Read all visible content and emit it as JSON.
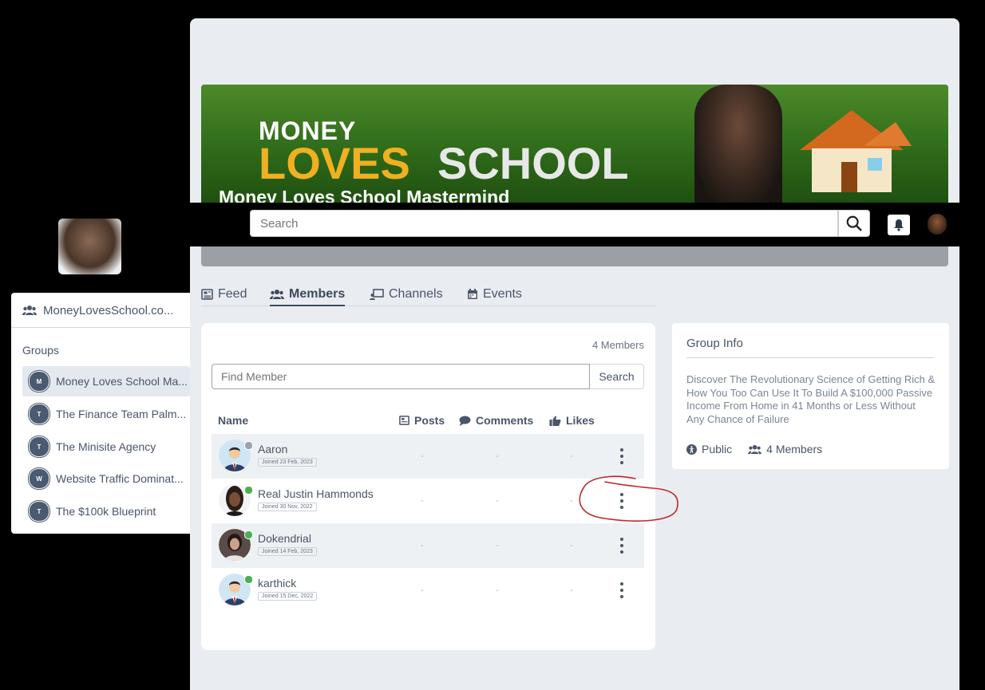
{
  "banner": {
    "money": "MONEY",
    "loves": "LOVES",
    "school": "SCHOOL",
    "title": "Money Loves School Mastermind"
  },
  "topbar": {
    "search_placeholder": "Search",
    "search_icon": "magnifier-icon",
    "bell_icon": "bell-icon"
  },
  "sidebar": {
    "site_label": "MoneyLovesSchool.co...",
    "groups_label": "Groups",
    "groups": [
      {
        "initial": "M",
        "label": "Money Loves School Ma...",
        "active": true
      },
      {
        "initial": "T",
        "label": "The Finance Team Palm...",
        "active": false
      },
      {
        "initial": "T",
        "label": "The Minisite Agency",
        "active": false
      },
      {
        "initial": "W",
        "label": "Website Traffic Dominat...",
        "active": false
      },
      {
        "initial": "T",
        "label": "The $100k Blueprint",
        "active": false
      }
    ]
  },
  "tabs": [
    {
      "label": "Feed",
      "icon": "newspaper-icon"
    },
    {
      "label": "Members",
      "icon": "users-icon",
      "active": true
    },
    {
      "label": "Channels",
      "icon": "channels-icon"
    },
    {
      "label": "Events",
      "icon": "calendar-icon"
    }
  ],
  "members": {
    "count_label": "4 Members",
    "find_placeholder": "Find Member",
    "find_button": "Search",
    "headers": {
      "name": "Name",
      "posts": "Posts",
      "comments": "Comments",
      "likes": "Likes"
    },
    "rows": [
      {
        "name": "Aaron",
        "joined": "Joined 23 Feb, 2023",
        "posts": "-",
        "comments": "-",
        "likes": "-",
        "online": false,
        "avatar": "default"
      },
      {
        "name": "Real Justin Hammonds",
        "joined": "Joined 30 Nov, 2022",
        "posts": "-",
        "comments": "-",
        "likes": "-",
        "online": true,
        "avatar": "photo"
      },
      {
        "name": "Dokendrial",
        "joined": "Joined 14 Feb, 2023",
        "posts": "-",
        "comments": "-",
        "likes": "-",
        "online": true,
        "avatar": "photo2"
      },
      {
        "name": "karthick",
        "joined": "Joined 15 Dec, 2022",
        "posts": "-",
        "comments": "-",
        "likes": "-",
        "online": true,
        "avatar": "default"
      }
    ]
  },
  "group_info": {
    "title": "Group Info",
    "description": "Discover The Revolutionary Science of Getting Rich & How You Too Can Use It To Build A $100,000 Passive Income From Home in 41 Months or Less Without Any Chance of Failure",
    "privacy": "Public",
    "members": "4 Members"
  },
  "colors": {
    "online": "#4caf50",
    "offline": "#9ca3af",
    "annotation": "#c0282a"
  }
}
